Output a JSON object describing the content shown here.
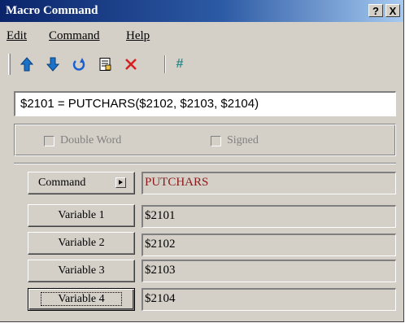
{
  "window": {
    "title": "Macro Command",
    "help_button": "?",
    "close_button": "X"
  },
  "menu": {
    "items": [
      {
        "label": "Edit"
      },
      {
        "label": "Command"
      },
      {
        "label": "Help"
      }
    ]
  },
  "toolbar": {
    "icons": [
      "arrow-up-icon",
      "arrow-down-icon",
      "undo-icon",
      "document-icon",
      "delete-icon",
      "hash-icon"
    ],
    "hash_label": "#"
  },
  "expression": {
    "value": "$2101 = PUTCHARS($2102, $2103, $2104)"
  },
  "options": {
    "double_word": "Double Word",
    "signed": "Signed"
  },
  "command": {
    "button_label": "Command",
    "value": "PUTCHARS"
  },
  "variables": [
    {
      "label": "Variable 1",
      "value": "$2101"
    },
    {
      "label": "Variable 2",
      "value": "$2102"
    },
    {
      "label": "Variable 3",
      "value": "$2103"
    },
    {
      "label": "Variable 4",
      "value": "$2104"
    }
  ],
  "colors": {
    "title_gradient_start": "#0a246a",
    "title_gradient_end": "#a6caf0",
    "command_text": "#8b1a1a",
    "face": "#d4d0c8"
  }
}
